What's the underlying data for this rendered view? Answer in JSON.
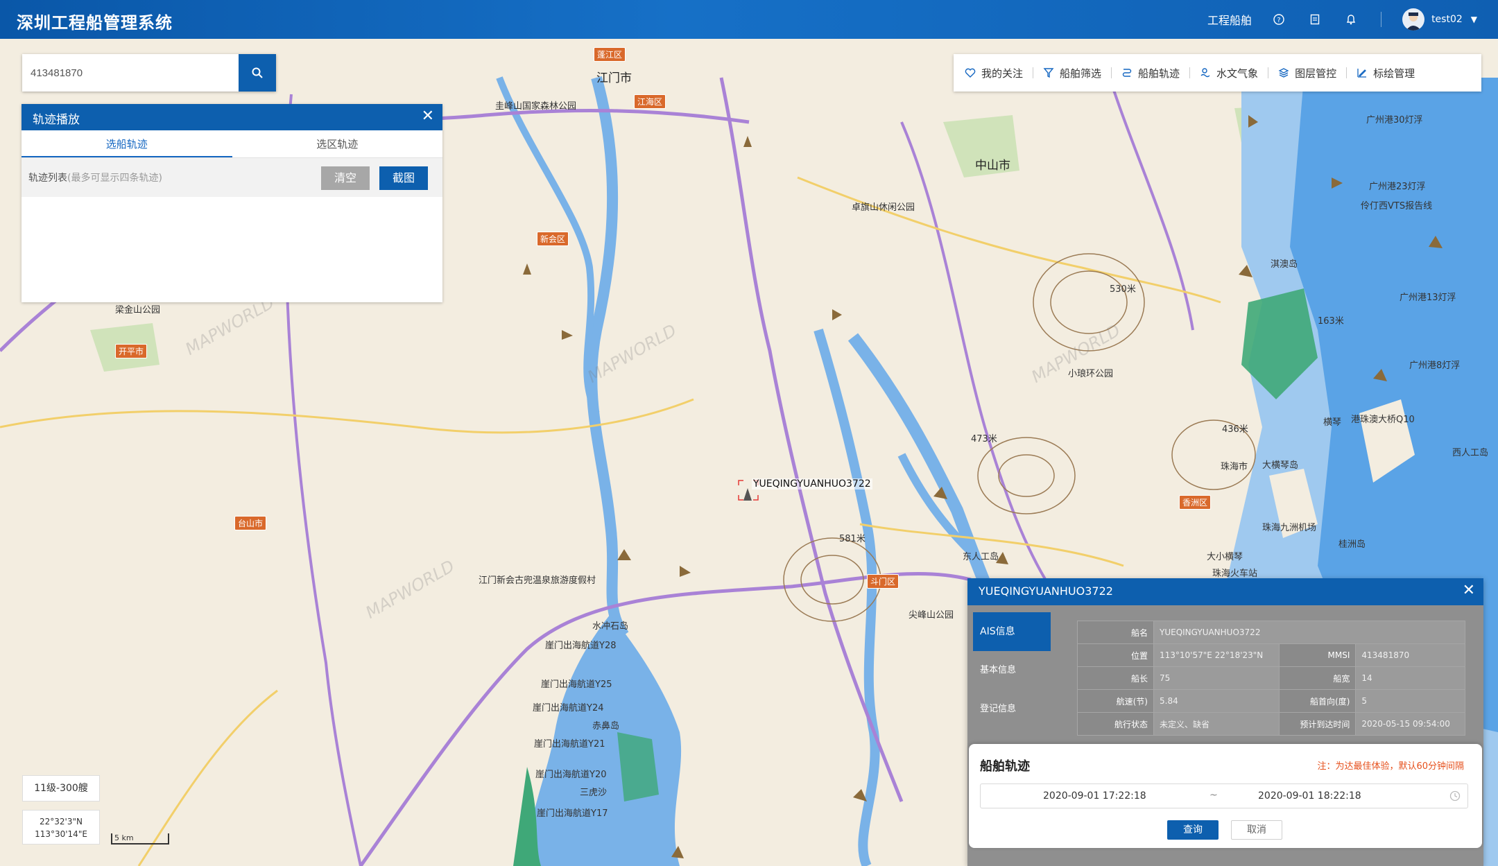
{
  "header": {
    "title": "深圳工程船管理系统",
    "nav_link": "工程船舶",
    "user_name": "test02",
    "icons": [
      "help-icon",
      "document-icon",
      "bell-icon",
      "user-avatar"
    ]
  },
  "search": {
    "value": "413481870"
  },
  "track_panel": {
    "title": "轨迹播放",
    "tabs": [
      "选船轨迹",
      "选区轨迹"
    ],
    "list_title": "轨迹列表",
    "list_hint": "(最多可显示四条轨迹)",
    "clear_label": "清空",
    "screenshot_label": "截图"
  },
  "toolbar": {
    "items": [
      {
        "label": "我的关注",
        "icon": "heart-icon"
      },
      {
        "label": "船舶筛选",
        "icon": "filter-icon"
      },
      {
        "label": "船舶轨迹",
        "icon": "route-icon"
      },
      {
        "label": "水文气象",
        "icon": "weather-icon"
      },
      {
        "label": "图层管控",
        "icon": "layers-icon"
      },
      {
        "label": "标绘管理",
        "icon": "draw-icon"
      }
    ]
  },
  "map": {
    "zoom_level": "11级-300艘",
    "coord_lat": "22°32'3\"N",
    "coord_lon": "113°30'14\"E",
    "scale": "5 km",
    "ship_label": "YUEQINGYUANHUO3722",
    "labels": [
      {
        "text": "江门市"
      },
      {
        "text": "中山市"
      },
      {
        "text": "新会区"
      },
      {
        "text": "开平市"
      },
      {
        "text": "台山市"
      },
      {
        "text": "斗门区"
      },
      {
        "text": "珠海市"
      },
      {
        "text": "香洲区"
      },
      {
        "text": "蓬江区"
      },
      {
        "text": "江海区"
      },
      {
        "text": "广州港30灯浮"
      },
      {
        "text": "广州港23灯浮"
      },
      {
        "text": "伶仃西VTS报告线"
      },
      {
        "text": "淇澳岛"
      },
      {
        "text": "广州港13灯浮"
      },
      {
        "text": "广州港8灯浮"
      },
      {
        "text": "港珠澳大桥Q10"
      },
      {
        "text": "崖门出海航道Y28"
      },
      {
        "text": "崖门出海航道Y25"
      },
      {
        "text": "崖门出海航道Y24"
      },
      {
        "text": "崖门出海航道Y21"
      },
      {
        "text": "崖门出海航道Y20"
      },
      {
        "text": "崖门出海航道Y17"
      },
      {
        "text": "水冲石岛"
      },
      {
        "text": "赤鼻岛"
      },
      {
        "text": "三虎沙"
      },
      {
        "text": "大横琴岛"
      },
      {
        "text": "珠海九洲机场"
      },
      {
        "text": "珠海火车站"
      },
      {
        "text": "大小横琴"
      },
      {
        "text": "581米"
      },
      {
        "text": "473米"
      },
      {
        "text": "436米"
      },
      {
        "text": "530米"
      },
      {
        "text": "163米"
      },
      {
        "text": "梁金山公园"
      },
      {
        "text": "圭峰山国家森林公园"
      },
      {
        "text": "卓旗山休闲公园"
      },
      {
        "text": "小琅环公园"
      },
      {
        "text": "尖峰山公园"
      },
      {
        "text": "江门新会古兜温泉旅游度假村"
      },
      {
        "text": "桂洲岛"
      },
      {
        "text": "横琴"
      },
      {
        "text": "西人工岛"
      },
      {
        "text": "东人工岛"
      }
    ]
  },
  "ship_panel": {
    "title": "YUEQINGYUANHUO3722",
    "side_tabs": [
      "AIS信息",
      "基本信息",
      "登记信息"
    ],
    "rows": [
      [
        {
          "k": "船名",
          "v": "YUEQINGYUANHUO3722"
        }
      ],
      [
        {
          "k": "位置",
          "v": "113°10'57\"E  22°18'23\"N"
        },
        {
          "k": "MMSI",
          "v": "413481870"
        }
      ],
      [
        {
          "k": "船长",
          "v": "75"
        },
        {
          "k": "船宽",
          "v": "14"
        }
      ],
      [
        {
          "k": "航速(节)",
          "v": "5.84"
        },
        {
          "k": "船首向(度)",
          "v": "5"
        }
      ],
      [
        {
          "k": "航行状态",
          "v": "未定义、缺省"
        },
        {
          "k": "预计到达时间",
          "v": "2020-05-15 09:54:00"
        }
      ]
    ]
  },
  "track_query": {
    "title": "船舶轨迹",
    "note": "注：为达最佳体验，默认60分钟间隔",
    "start": "2020-09-01 17:22:18",
    "separator": "~",
    "end": "2020-09-01 18:22:18",
    "query_label": "查询",
    "cancel_label": "取消"
  }
}
